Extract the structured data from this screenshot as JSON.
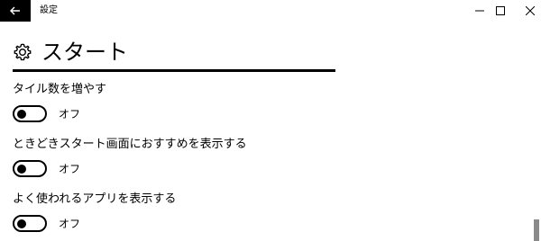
{
  "window": {
    "title": "設定"
  },
  "header": {
    "title": "スタート",
    "icon": "gear-icon"
  },
  "settings": [
    {
      "label": "タイル数を増やす",
      "state": "オフ",
      "on": false
    },
    {
      "label": "ときどきスタート画面におすすめを表示する",
      "state": "オフ",
      "on": false
    },
    {
      "label": "よく使われるアプリを表示する",
      "state": "オフ",
      "on": false
    }
  ],
  "colors": {
    "accent": "#000000",
    "background": "#ffffff",
    "scroll_thumb": "#8a8a8a"
  }
}
